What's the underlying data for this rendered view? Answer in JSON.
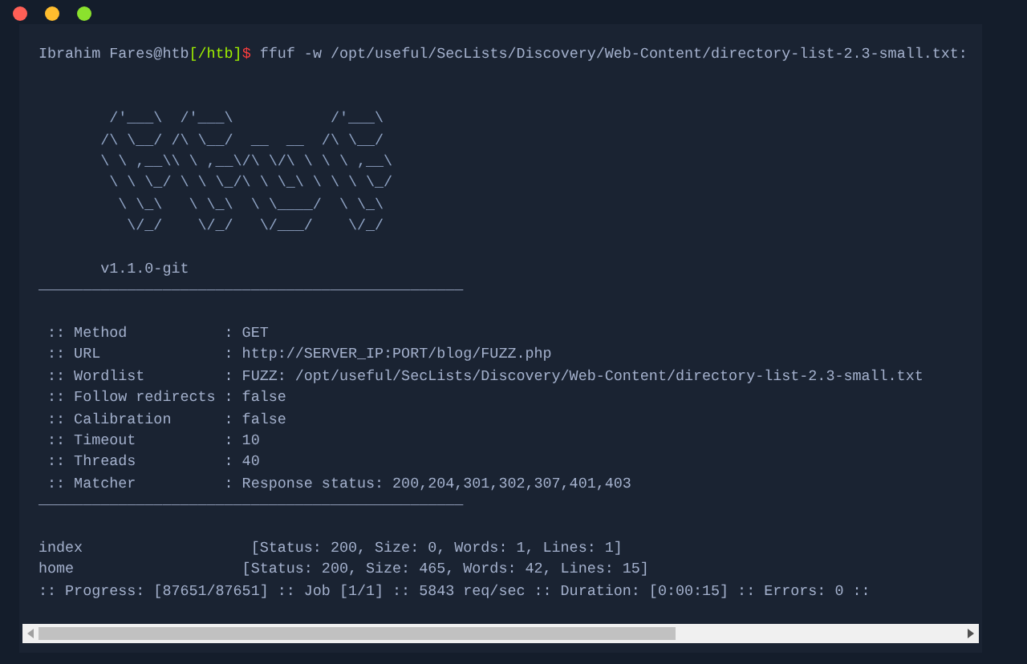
{
  "window": {
    "controls": [
      {
        "color": "#ff5f56"
      },
      {
        "color": "#ffbd2e"
      },
      {
        "color": "#8be22d"
      }
    ]
  },
  "terminal": {
    "lines": [
      {
        "kind": "prompt",
        "user_host": "Ibrahim Fares@htb",
        "cwd": "[/htb]",
        "symbol": "$",
        "command": " ffuf -w /opt/useful/SecLists/Discovery/Web-Content/directory-list-2.3-small.txt:"
      },
      {
        "kind": "blank"
      },
      {
        "kind": "blank"
      },
      {
        "kind": "art",
        "text": "        /'___\\  /'___\\           /'___\\"
      },
      {
        "kind": "art",
        "text": "       /\\ \\__/ /\\ \\__/  __  __  /\\ \\__/"
      },
      {
        "kind": "art",
        "text": "       \\ \\ ,__\\\\ \\ ,__\\/\\ \\/\\ \\ \\ \\ ,__\\"
      },
      {
        "kind": "art",
        "text": "        \\ \\ \\_/ \\ \\ \\_/\\ \\ \\_\\ \\ \\ \\ \\_/"
      },
      {
        "kind": "art",
        "text": "         \\ \\_\\   \\ \\_\\  \\ \\____/  \\ \\_\\"
      },
      {
        "kind": "art",
        "text": "          \\/_/    \\/_/   \\/___/    \\/_/"
      },
      {
        "kind": "blank"
      },
      {
        "kind": "text",
        "text": "       v1.1.0-git"
      },
      {
        "kind": "separator",
        "text": "________________________________________________"
      },
      {
        "kind": "blank"
      },
      {
        "kind": "text",
        "text": " :: Method           : GET"
      },
      {
        "kind": "text",
        "text": " :: URL              : http://SERVER_IP:PORT/blog/FUZZ.php"
      },
      {
        "kind": "text",
        "text": " :: Wordlist         : FUZZ: /opt/useful/SecLists/Discovery/Web-Content/directory-list-2.3-small.txt"
      },
      {
        "kind": "text",
        "text": " :: Follow redirects : false"
      },
      {
        "kind": "text",
        "text": " :: Calibration      : false"
      },
      {
        "kind": "text",
        "text": " :: Timeout          : 10"
      },
      {
        "kind": "text",
        "text": " :: Threads          : 40"
      },
      {
        "kind": "text",
        "text": " :: Matcher          : Response status: 200,204,301,302,307,401,403"
      },
      {
        "kind": "separator",
        "text": "________________________________________________"
      },
      {
        "kind": "blank"
      },
      {
        "kind": "text",
        "text": "index                   [Status: 200, Size: 0, Words: 1, Lines: 1]"
      },
      {
        "kind": "text",
        "text": "home                   [Status: 200, Size: 465, Words: 42, Lines: 15]"
      },
      {
        "kind": "text",
        "text": ":: Progress: [87651/87651] :: Job [1/1] :: 5843 req/sec :: Duration: [0:00:15] :: Errors: 0 ::"
      }
    ]
  }
}
